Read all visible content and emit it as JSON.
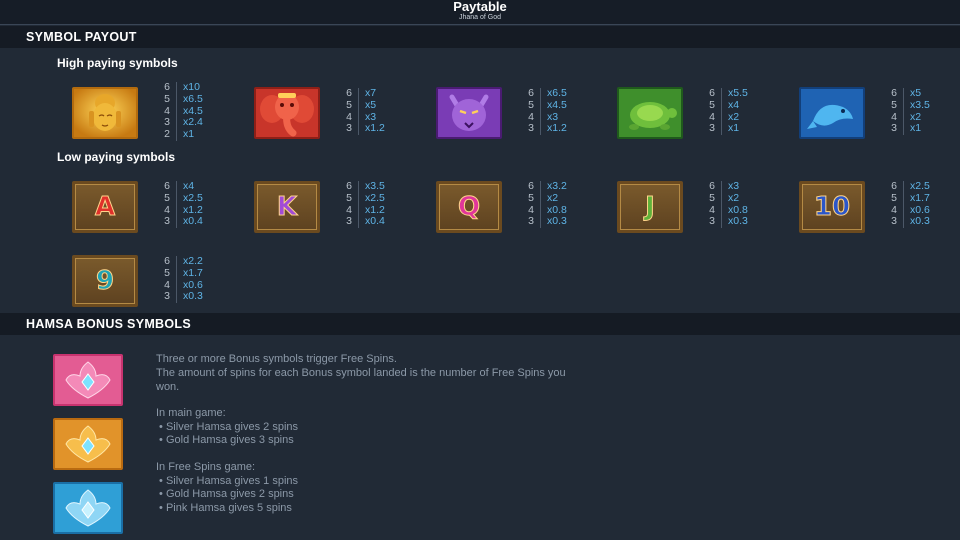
{
  "header": {
    "title": "Paytable",
    "subtitle": "Jhana of God"
  },
  "sections": {
    "symbol_payout": "SYMBOL PAYOUT",
    "hamsa_bonus": "HAMSA BONUS SYMBOLS"
  },
  "groups": {
    "high": "High paying symbols",
    "low": "Low paying symbols"
  },
  "high_symbols": [
    {
      "name": "buddha",
      "rows": [
        [
          "6",
          "x10"
        ],
        [
          "5",
          "x6.5"
        ],
        [
          "4",
          "x4.5"
        ],
        [
          "3",
          "x2.4"
        ],
        [
          "2",
          "x1"
        ]
      ]
    },
    {
      "name": "elephant",
      "rows": [
        [
          "6",
          "x7"
        ],
        [
          "5",
          "x5"
        ],
        [
          "4",
          "x3"
        ],
        [
          "3",
          "x1.2"
        ]
      ]
    },
    {
      "name": "panther",
      "rows": [
        [
          "6",
          "x6.5"
        ],
        [
          "5",
          "x4.5"
        ],
        [
          "4",
          "x3"
        ],
        [
          "3",
          "x1.2"
        ]
      ]
    },
    {
      "name": "turtle",
      "rows": [
        [
          "6",
          "x5.5"
        ],
        [
          "5",
          "x4"
        ],
        [
          "4",
          "x2"
        ],
        [
          "3",
          "x1"
        ]
      ]
    },
    {
      "name": "fish",
      "rows": [
        [
          "6",
          "x5"
        ],
        [
          "5",
          "x3.5"
        ],
        [
          "4",
          "x2"
        ],
        [
          "3",
          "x1"
        ]
      ]
    }
  ],
  "low_symbols": [
    {
      "name": "A",
      "color": "#e0312b",
      "rows": [
        [
          "6",
          "x4"
        ],
        [
          "5",
          "x2.5"
        ],
        [
          "4",
          "x1.2"
        ],
        [
          "3",
          "x0.4"
        ]
      ]
    },
    {
      "name": "K",
      "color": "#a24bd6",
      "rows": [
        [
          "6",
          "x3.5"
        ],
        [
          "5",
          "x2.5"
        ],
        [
          "4",
          "x1.2"
        ],
        [
          "3",
          "x0.4"
        ]
      ]
    },
    {
      "name": "Q",
      "color": "#e0369a",
      "rows": [
        [
          "6",
          "x3.2"
        ],
        [
          "5",
          "x2"
        ],
        [
          "4",
          "x0.8"
        ],
        [
          "3",
          "x0.3"
        ]
      ]
    },
    {
      "name": "J",
      "color": "#5fb23a",
      "rows": [
        [
          "6",
          "x3"
        ],
        [
          "5",
          "x2"
        ],
        [
          "4",
          "x0.8"
        ],
        [
          "3",
          "x0.3"
        ]
      ]
    },
    {
      "name": "10",
      "color": "#2b56c9",
      "rows": [
        [
          "6",
          "x2.5"
        ],
        [
          "5",
          "x1.7"
        ],
        [
          "4",
          "x0.6"
        ],
        [
          "3",
          "x0.3"
        ]
      ]
    },
    {
      "name": "9",
      "color": "#1fa3b5",
      "rows": [
        [
          "6",
          "x2.2"
        ],
        [
          "5",
          "x1.7"
        ],
        [
          "4",
          "x0.6"
        ],
        [
          "3",
          "x0.3"
        ]
      ]
    }
  ],
  "bonus": {
    "icons": [
      {
        "name": "pink-hamsa",
        "color": "#e0478e"
      },
      {
        "name": "gold-hamsa",
        "color": "#e2972a"
      },
      {
        "name": "silver-hamsa",
        "color": "#2f9fd6"
      }
    ],
    "text": [
      "Three or more Bonus symbols trigger Free Spins.",
      "The amount of spins for each Bonus symbol landed is the number of Free Spins you",
      "won.",
      "In main game:",
      " • Silver Hamsa gives 2 spins",
      " • Gold Hamsa gives 3 spins",
      "In Free Spins game:",
      " • Silver Hamsa gives 1 spins",
      " • Gold Hamsa gives 2 spins",
      " • Pink Hamsa gives 5 spins"
    ]
  }
}
